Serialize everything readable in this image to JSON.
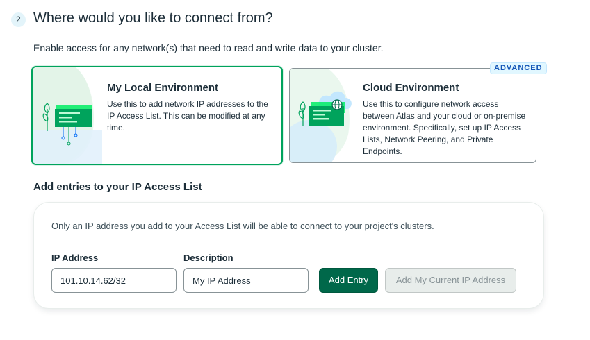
{
  "step": {
    "number": "2",
    "title": "Where would you like to connect from?",
    "description": "Enable access for any network(s) that need to read and write data to your cluster."
  },
  "environments": {
    "local": {
      "title": "My Local Environment",
      "description": "Use this to add network IP addresses to the IP Access List. This can be modified at any time.",
      "selected": true,
      "icon": "local-network-illustration"
    },
    "cloud": {
      "title": "Cloud Environment",
      "description": "Use this to configure network access between Atlas and your cloud or on-premise environment. Specifically, set up IP Access Lists, Network Peering, and Private Endpoints.",
      "badge": "ADVANCED",
      "selected": false,
      "icon": "cloud-network-illustration"
    }
  },
  "access_list": {
    "title": "Add entries to your IP Access List",
    "note": "Only an IP address you add to your Access List will be able to connect to your project's clusters.",
    "ip_label": "IP Address",
    "ip_value": "101.10.14.62/32",
    "description_label": "Description",
    "description_value": "My IP Address",
    "add_entry_label": "Add Entry",
    "add_current_ip_label": "Add My Current IP Address"
  },
  "colors": {
    "primary_green": "#00684a",
    "selected_border": "#00a35c",
    "badge_blue": "#1254b7"
  }
}
